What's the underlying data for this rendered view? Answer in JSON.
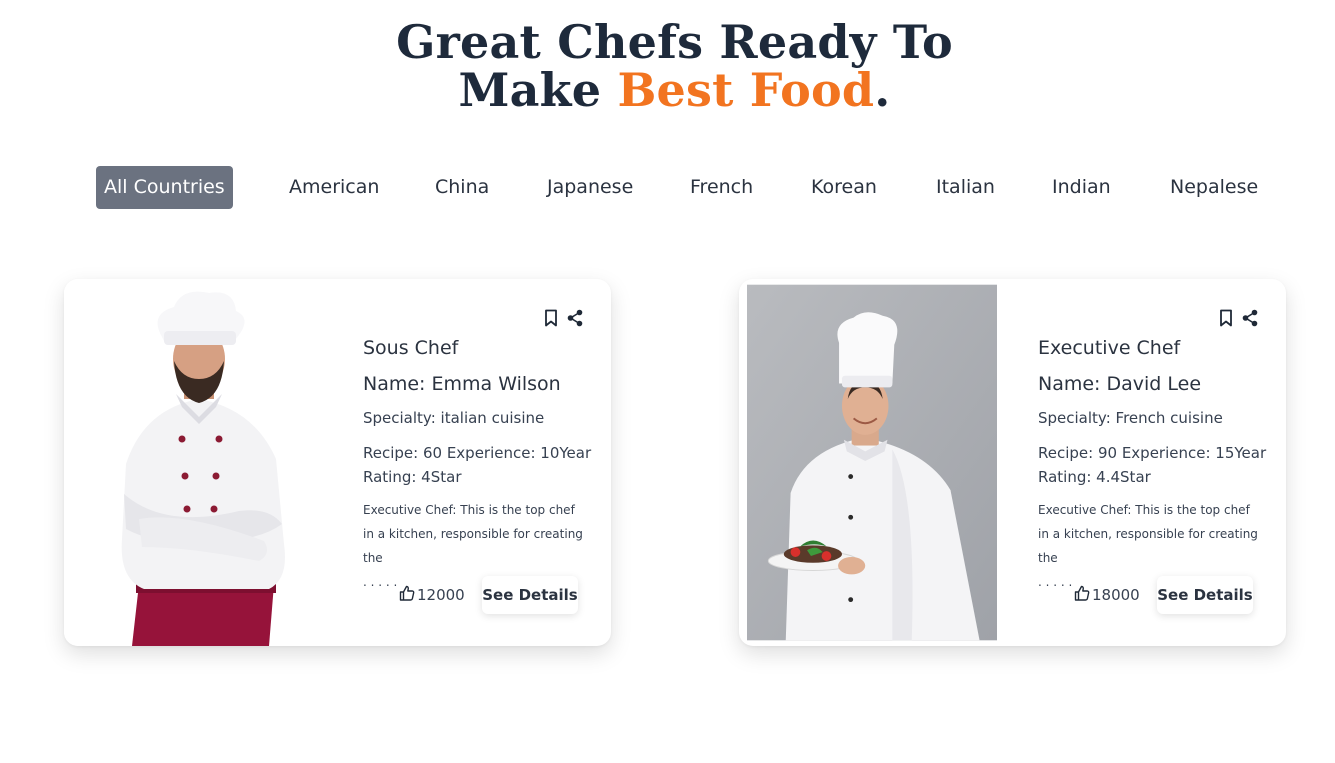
{
  "header": {
    "line1": "Great Chefs Ready To",
    "line2_prefix": "Make ",
    "line2_accent": "Best Food",
    "line2_suffix": "."
  },
  "filters": [
    "All Countries",
    "American",
    "China",
    "Japanese",
    "French",
    "Korean",
    "Italian",
    "Indian",
    "Nepalese"
  ],
  "active_filter": "All Countries",
  "cards": [
    {
      "title": "Sous Chef",
      "name": "Name: Emma Wilson",
      "specialty": "Specialty: italian cuisine",
      "stats_line1": "Recipe: 60 Experience: 10Year",
      "stats_line2": "Rating: 4Star",
      "description": "Executive Chef: This is the top chef in a kitchen, responsible for creating the",
      "ellipsis": ". . . . .",
      "likes": "12000",
      "button": "See Details"
    },
    {
      "title": "Executive Chef",
      "name": "Name: David Lee",
      "specialty": "Specialty: French cuisine",
      "stats_line1": "Recipe: 90 Experience: 15Year",
      "stats_line2": "Rating: 4.4Star",
      "description": "Executive Chef: This is the top chef in a kitchen, responsible for creating the",
      "ellipsis": ". . . . .",
      "likes": "18000",
      "button": "See Details"
    }
  ],
  "colors": {
    "accent": "#f27420",
    "heading": "#1e2a3b",
    "active_filter_bg": "#6b7280"
  },
  "icons": [
    "bookmark-icon",
    "share-icon",
    "thumbs-up-icon"
  ]
}
